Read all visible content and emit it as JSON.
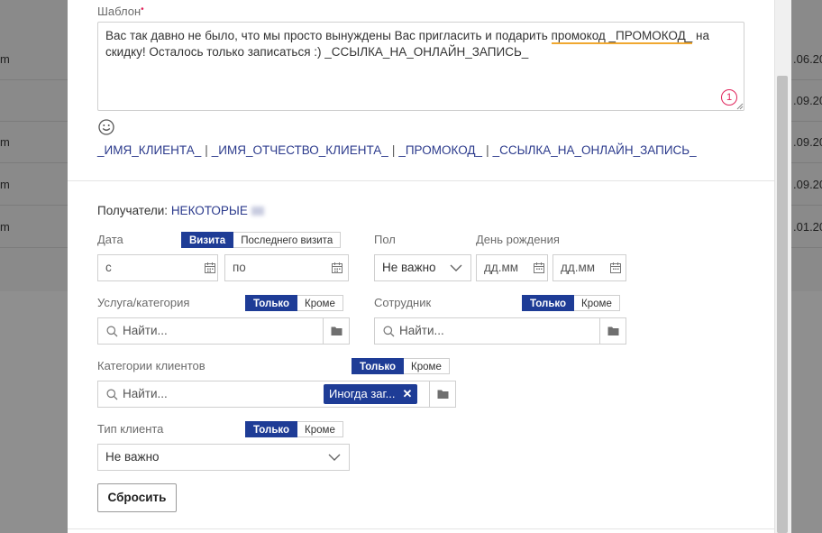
{
  "background": {
    "rows": [
      {
        "left": "m",
        "right": ".06.20"
      },
      {
        "left": "",
        "right": ".09.20"
      },
      {
        "left": "m",
        "right": ".09.20"
      },
      {
        "left": "m",
        "right": ".09.20"
      },
      {
        "left": "m",
        "right": ".01.20"
      }
    ]
  },
  "template": {
    "label": "Шаблон",
    "text_before": "Вас так давно не было, что мы просто вынуждены Вас пригласить и подарить ",
    "text_keyword": "промокод _ПРОМОКОД_",
    "text_after": " на скидку! Осталось только записаться :) _ССЫЛКА_НА_ОНЛАЙН_ЗАПИСЬ_",
    "counter": "1"
  },
  "variables": [
    "_ИМЯ_КЛИЕНТА_",
    "_ИМЯ_ОТЧЕСТВО_КЛИЕНТА_",
    "_ПРОМОКОД_",
    "_ССЫЛКА_НА_ОНЛАЙН_ЗАПИСЬ_"
  ],
  "variable_separator": "|",
  "recipients": {
    "label": "Получатели:",
    "value": "НЕКОТОРЫЕ"
  },
  "date": {
    "label": "Дата",
    "toggle_visit": "Визита",
    "toggle_last_visit": "Последнего визита",
    "from_placeholder": "с",
    "to_placeholder": "по"
  },
  "gender": {
    "label": "Пол",
    "value": "Не важно"
  },
  "birthday": {
    "label": "День рождения",
    "from_placeholder": "дд.мм",
    "to_placeholder": "дд.мм"
  },
  "toggles": {
    "only": "Только",
    "except": "Кроме"
  },
  "service": {
    "label": "Услуга/категория",
    "placeholder": "Найти..."
  },
  "employee": {
    "label": "Сотрудник",
    "placeholder": "Найти..."
  },
  "client_categories": {
    "label": "Категории клиентов",
    "placeholder": "Найти...",
    "chip": "Иногда заг..."
  },
  "client_type": {
    "label": "Тип клиента",
    "value": "Не важно"
  },
  "reset_label": "Сбросить",
  "colors": {
    "accent": "#1e3c96",
    "link": "#2b3a8c",
    "required": "#e0235a",
    "highlight": "#f0a830"
  }
}
